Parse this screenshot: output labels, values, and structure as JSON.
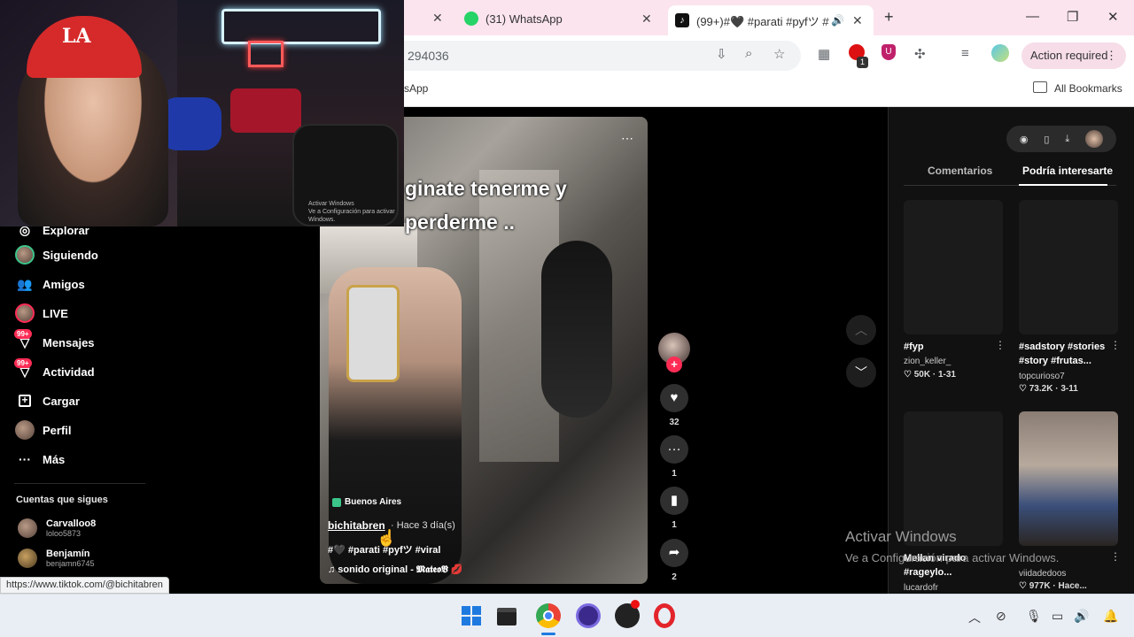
{
  "browser": {
    "tabs": [
      {
        "label": "(31) WhatsApp",
        "active": false
      },
      {
        "label": "(99+)#🖤 #parati #pyfツ #v",
        "active": true
      }
    ],
    "new_tab_label": "+",
    "url_partial": "294036",
    "action_required_label": "Action required",
    "bookmark_partial": "sApp",
    "all_bookmarks_label": "All Bookmarks",
    "extension_badge": "1",
    "status_url": "https://www.tiktok.com/@bichitabren"
  },
  "webcam": {
    "cap_text": "LA",
    "watermark_line1": "Activar Windows",
    "watermark_line2": "Ve a Configuración para activar Windows."
  },
  "sidebar": {
    "partial_item": "Explorar",
    "items": [
      {
        "label": "Siguiendo",
        "icon": "avatar-icon"
      },
      {
        "label": "Amigos",
        "icon": "friends-icon"
      },
      {
        "label": "LIVE",
        "icon": "live-icon"
      },
      {
        "label": "Mensajes",
        "icon": "messages-icon",
        "badge": "99+"
      },
      {
        "label": "Actividad",
        "icon": "activity-icon",
        "badge": "99+"
      },
      {
        "label": "Cargar",
        "icon": "upload-icon"
      },
      {
        "label": "Perfil",
        "icon": "profile-icon"
      },
      {
        "label": "Más",
        "icon": "more-icon"
      }
    ],
    "following_title": "Cuentas que sigues",
    "following": [
      {
        "name": "Carvalloo8",
        "handle": "loloo5873"
      },
      {
        "name": "Benjamín",
        "handle": "benjamn6745"
      }
    ]
  },
  "video": {
    "caption_line1": "ginate tenerme y",
    "caption_line2": "perderme ..",
    "location": "Buenos Aires",
    "username": "bichitabren",
    "time": "· Hace 3 día(s)",
    "tags": "#🖤 #parati #pyfツ #viral",
    "sound": "♫  sonido original - 𝕸𝖆𝖙𝖊𝖔𝖁 💋",
    "likes": "32",
    "comments": "1",
    "saves": "1",
    "shares": "2"
  },
  "right_panel": {
    "tab_comments": "Comentarios",
    "tab_suggested": "Podría interesarte",
    "videos": [
      {
        "title": "#fyp",
        "author": "zion_keller_",
        "stats": "♡ 50K · 1-31"
      },
      {
        "title": "#sadstory #stories #story #frutas...",
        "author": "topcurioso7",
        "stats": "♡ 73.2K · 3-11"
      },
      {
        "title": "Mellan virado #rageylo...",
        "author": "lucardofr",
        "stats": ""
      },
      {
        "title": "",
        "author": "viidadedoos",
        "stats": "♡ 977K · Hace..."
      }
    ]
  },
  "windows_watermark": {
    "title": "Activar Windows",
    "subtitle": "Ve a Configuración para activar Windows."
  },
  "colors": {
    "tiktok_red": "#fe2c55",
    "tab_strip": "#fbe4ee"
  }
}
